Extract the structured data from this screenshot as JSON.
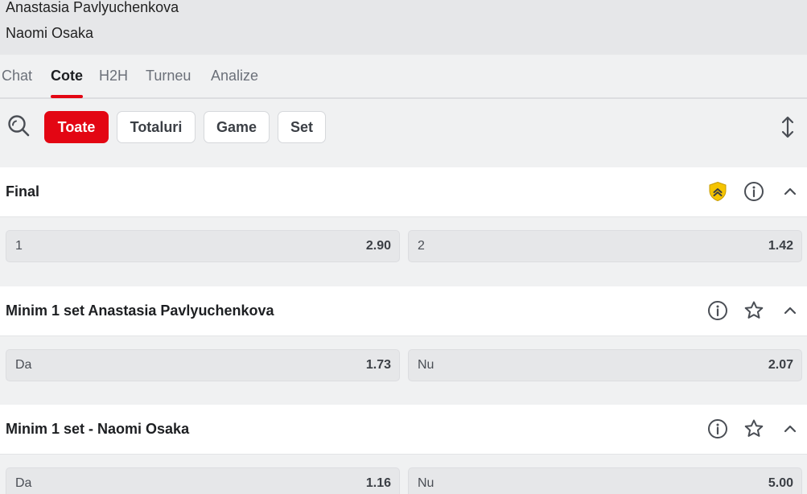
{
  "match": {
    "player1": "Anastasia Pavlyuchenkova",
    "player2": "Naomi Osaka"
  },
  "tabs": [
    {
      "label": "Chat",
      "active": false
    },
    {
      "label": "Cote",
      "active": true
    },
    {
      "label": "H2H",
      "active": false
    },
    {
      "label": "Turneu",
      "active": false
    },
    {
      "label": "Analize",
      "active": false
    }
  ],
  "filters": [
    {
      "label": "Toate",
      "active": true
    },
    {
      "label": "Totaluri",
      "active": false
    },
    {
      "label": "Game",
      "active": false
    },
    {
      "label": "Set",
      "active": false
    }
  ],
  "icons": {
    "search": "search-icon",
    "expand": "expand-collapse-icon",
    "shield": "shield-icon",
    "info": "info-icon",
    "star": "star-icon",
    "chevron": "chevron-up-icon"
  },
  "colors": {
    "accent": "#e30613",
    "shield": "#f5c400"
  },
  "markets": [
    {
      "title": "Final",
      "outcomes": [
        {
          "label": "1",
          "odds": "2.90"
        },
        {
          "label": "2",
          "odds": "1.42"
        }
      ]
    },
    {
      "title": "Minim 1 set Anastasia Pavlyuchenkova",
      "outcomes": [
        {
          "label": "Da",
          "odds": "1.73"
        },
        {
          "label": "Nu",
          "odds": "2.07"
        }
      ]
    },
    {
      "title": "Minim 1 set - Naomi Osaka",
      "outcomes": [
        {
          "label": "Da",
          "odds": "1.16"
        },
        {
          "label": "Nu",
          "odds": "5.00"
        }
      ]
    }
  ]
}
